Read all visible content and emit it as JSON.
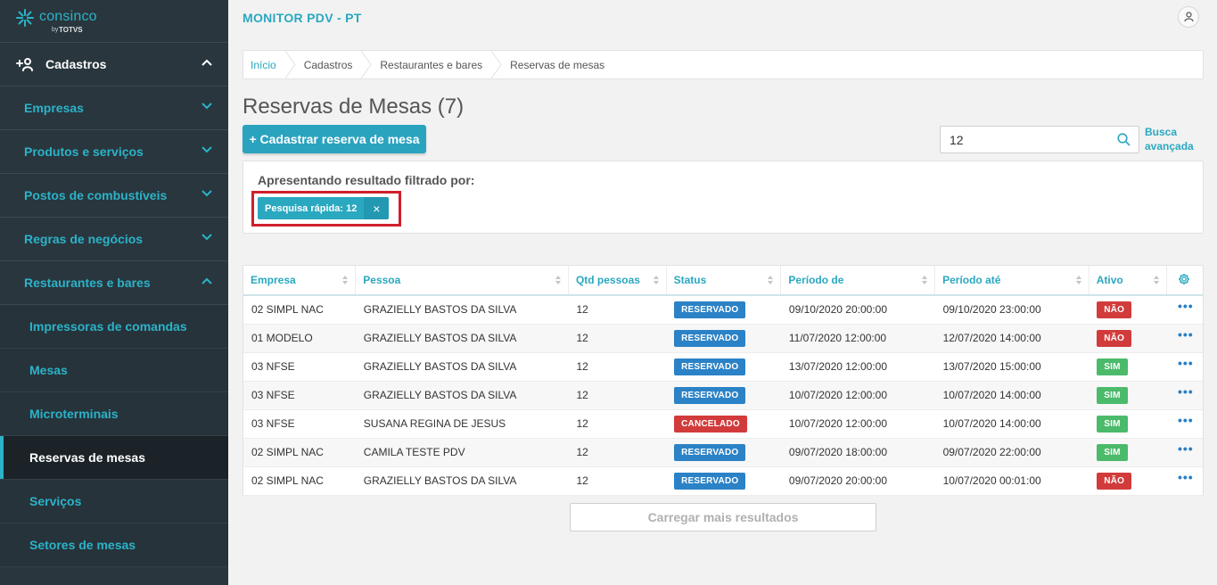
{
  "sidebar": {
    "logo": {
      "brand": "consinco",
      "by": "by",
      "totvs": "TOTVS"
    },
    "section": {
      "label": "Cadastros"
    },
    "items": [
      {
        "label": "Empresas"
      },
      {
        "label": "Produtos e serviços"
      },
      {
        "label": "Postos de combustíveis"
      },
      {
        "label": "Regras de negócios"
      },
      {
        "label": "Restaurantes e bares"
      }
    ],
    "subitems": [
      {
        "label": "Impressoras de comandas"
      },
      {
        "label": "Mesas"
      },
      {
        "label": "Microterminais"
      },
      {
        "label": "Reservas de mesas"
      },
      {
        "label": "Serviços"
      },
      {
        "label": "Setores de mesas"
      }
    ]
  },
  "header": {
    "app_title": "MONITOR PDV - PT"
  },
  "breadcrumb": [
    "Início",
    "Cadastros",
    "Restaurantes e bares",
    "Reservas de mesas"
  ],
  "page": {
    "title": "Reservas de Mesas (7)",
    "new_button": "+ Cadastrar reserva de mesa",
    "search_value": "12",
    "advanced_search": "Busca avançada"
  },
  "filter": {
    "title": "Apresentando resultado filtrado por:",
    "chip": "Pesquisa rápida: 12",
    "chip_remove": "×"
  },
  "table": {
    "columns": [
      "Empresa",
      "Pessoa",
      "Qtd pessoas",
      "Status",
      "Período de",
      "Período até",
      "Ativo"
    ],
    "rows": [
      {
        "empresa": "02 SIMPL NAC",
        "pessoa": "GRAZIELLY BASTOS DA SILVA",
        "qtd": "12",
        "status": "RESERVADO",
        "de": "09/10/2020 20:00:00",
        "ate": "09/10/2020 23:00:00",
        "ativo": "NÃO"
      },
      {
        "empresa": "01 MODELO",
        "pessoa": "GRAZIELLY BASTOS DA SILVA",
        "qtd": "12",
        "status": "RESERVADO",
        "de": "11/07/2020 12:00:00",
        "ate": "12/07/2020 14:00:00",
        "ativo": "NÃO"
      },
      {
        "empresa": "03 NFSE",
        "pessoa": "GRAZIELLY BASTOS DA SILVA",
        "qtd": "12",
        "status": "RESERVADO",
        "de": "13/07/2020 12:00:00",
        "ate": "13/07/2020 15:00:00",
        "ativo": "SIM"
      },
      {
        "empresa": "03 NFSE",
        "pessoa": "GRAZIELLY BASTOS DA SILVA",
        "qtd": "12",
        "status": "RESERVADO",
        "de": "10/07/2020 12:00:00",
        "ate": "10/07/2020 14:00:00",
        "ativo": "SIM"
      },
      {
        "empresa": "03 NFSE",
        "pessoa": "SUSANA REGINA DE JESUS",
        "qtd": "12",
        "status": "CANCELADO",
        "de": "10/07/2020 12:00:00",
        "ate": "10/07/2020 14:00:00",
        "ativo": "SIM"
      },
      {
        "empresa": "02 SIMPL NAC",
        "pessoa": "CAMILA TESTE PDV",
        "qtd": "12",
        "status": "RESERVADO",
        "de": "09/07/2020 18:00:00",
        "ate": "09/07/2020 22:00:00",
        "ativo": "SIM"
      },
      {
        "empresa": "02 SIMPL NAC",
        "pessoa": "GRAZIELLY BASTOS DA SILVA",
        "qtd": "12",
        "status": "RESERVADO",
        "de": "09/07/2020 20:00:00",
        "ate": "10/07/2020 00:01:00",
        "ativo": "NÃO"
      }
    ],
    "row_actions": "•••"
  },
  "load_more": "Carregar mais resultados",
  "colors": {
    "accent": "#2aa8c0",
    "sidebar": "#29363d",
    "reserved": "#2b82c6",
    "cancelled": "#d23b3b",
    "yes": "#4cba6b",
    "no": "#d23b3b"
  },
  "icons": {
    "logo": "consinco-star-icon",
    "user": "user-icon",
    "search": "search-icon",
    "settings": "gear-icon"
  }
}
